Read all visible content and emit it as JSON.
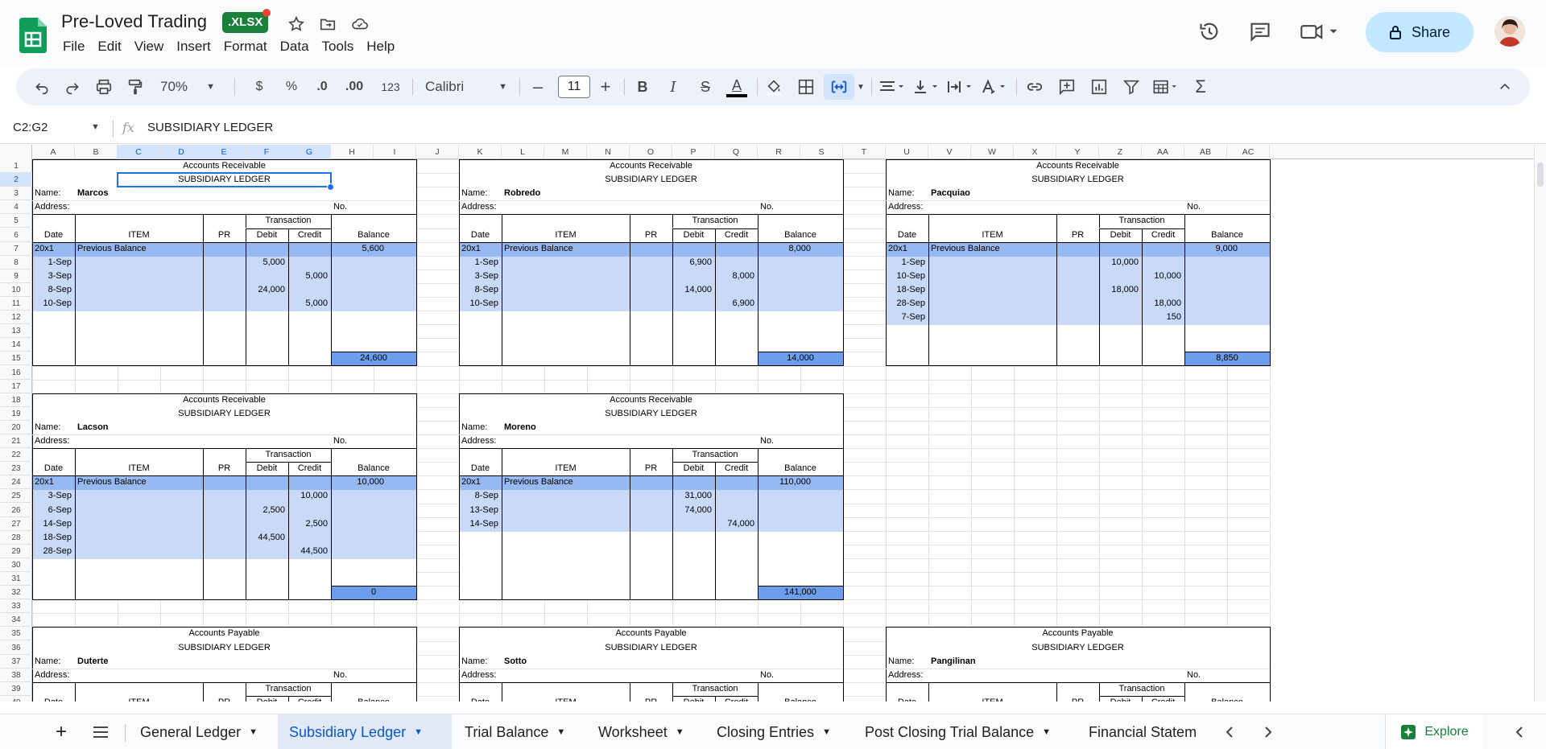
{
  "app": {
    "doc_title": "Pre-Loved Trading",
    "file_badge": ".XLSX",
    "menus": [
      "File",
      "Edit",
      "View",
      "Insert",
      "Format",
      "Data",
      "Tools",
      "Help"
    ],
    "share_label": "Share"
  },
  "toolbar": {
    "zoom": "70%",
    "currency": "$",
    "percent": "%",
    "dec_dec": ".0",
    "dec_inc": ".00",
    "number_format": "123",
    "font": "Calibri",
    "font_size": "11",
    "bold": "B",
    "italic": "I",
    "strike": "S",
    "text_color_letter": "A"
  },
  "formula_bar": {
    "name_box": "C2:G2",
    "fx": "fx",
    "value": "SUBSIDIARY LEDGER"
  },
  "columns": [
    "A",
    "B",
    "C",
    "D",
    "E",
    "F",
    "G",
    "H",
    "I",
    "J",
    "K",
    "L",
    "M",
    "N",
    "O",
    "P",
    "Q",
    "R",
    "S",
    "T",
    "U",
    "V",
    "W",
    "X",
    "Y",
    "Z",
    "AA",
    "AB",
    "AC"
  ],
  "selected_columns": [
    "C",
    "D",
    "E",
    "F",
    "G"
  ],
  "rows": [
    "1",
    "2",
    "3",
    "4",
    "5",
    "6",
    "7",
    "8",
    "9",
    "10",
    "11",
    "12",
    "13",
    "14",
    "15",
    "16",
    "17",
    "18",
    "19",
    "20",
    "21",
    "22",
    "23",
    "24",
    "25",
    "26",
    "27",
    "28",
    "29",
    "30",
    "31",
    "32",
    "33",
    "34",
    "35",
    "36",
    "37",
    "38",
    "39",
    "40"
  ],
  "selected_row": "2",
  "ledger_labels": {
    "name": "Name:",
    "address": "Address:",
    "no": "No.",
    "transaction": "Transaction",
    "date": "Date",
    "item": "ITEM",
    "pr": "PR",
    "debit": "Debit",
    "credit": "Credit",
    "balance": "Balance",
    "subsidiary": "SUBSIDIARY LEDGER"
  },
  "ledgers": [
    {
      "title": "Accounts Receivable",
      "name": "Marcos",
      "year": "20x1",
      "prev_label": "Previous Balance",
      "prev_balance": "5,600",
      "entries": [
        [
          "1-Sep",
          "5,000",
          ""
        ],
        [
          "3-Sep",
          "",
          "5,000"
        ],
        [
          "8-Sep",
          "24,000",
          ""
        ],
        [
          "10-Sep",
          "",
          "5,000"
        ]
      ],
      "total": "24,600"
    },
    {
      "title": "Accounts Receivable",
      "name": "Robredo",
      "year": "20x1",
      "prev_label": "Previous Balance",
      "prev_balance": "8,000",
      "entries": [
        [
          "1-Sep",
          "6,900",
          ""
        ],
        [
          "3-Sep",
          "",
          "8,000"
        ],
        [
          "8-Sep",
          "14,000",
          ""
        ],
        [
          "10-Sep",
          "",
          "6,900"
        ]
      ],
      "total": "14,000"
    },
    {
      "title": "Accounts Receivable",
      "name": "Pacquiao",
      "year": "20x1",
      "prev_label": "Previous Balance",
      "prev_balance": "9,000",
      "entries": [
        [
          "1-Sep",
          "10,000",
          ""
        ],
        [
          "10-Sep",
          "",
          "10,000"
        ],
        [
          "18-Sep",
          "18,000",
          ""
        ],
        [
          "28-Sep",
          "",
          "18,000"
        ],
        [
          "7-Sep",
          "",
          "150"
        ]
      ],
      "total": "8,850"
    },
    {
      "title": "Accounts Receivable",
      "name": "Lacson",
      "year": "20x1",
      "prev_label": "Previous Balance",
      "prev_balance": "10,000",
      "entries": [
        [
          "3-Sep",
          "",
          "10,000"
        ],
        [
          "6-Sep",
          "2,500",
          ""
        ],
        [
          "14-Sep",
          "",
          "2,500"
        ],
        [
          "18-Sep",
          "44,500",
          ""
        ],
        [
          "28-Sep",
          "",
          "44,500"
        ]
      ],
      "total": "0"
    },
    {
      "title": "Accounts Receivable",
      "name": "Moreno",
      "year": "20x1",
      "prev_label": "Previous Balance",
      "prev_balance": "110,000",
      "entries": [
        [
          "8-Sep",
          "31,000",
          ""
        ],
        [
          "13-Sep",
          "74,000",
          ""
        ],
        [
          "14-Sep",
          "",
          "74,000"
        ]
      ],
      "total": "141,000"
    },
    {
      "title": "Accounts Payable",
      "name": "Duterte"
    },
    {
      "title": "Accounts Payable",
      "name": "Sotto"
    },
    {
      "title": "Accounts Payable",
      "name": "Pangilinan"
    }
  ],
  "sheets": [
    "General Ledger",
    "Subsidiary Ledger",
    "Trial Balance",
    "Worksheet",
    "Closing Entries",
    "Post Closing Trial Balance",
    "Financial Statem"
  ],
  "active_sheet": "Subsidiary Ledger",
  "explore_label": "Explore",
  "colors": {
    "accent": "#1a73e8",
    "row_fill": "#c9daf8",
    "total_fill": "#6d9eeb",
    "brand": "#188038"
  }
}
